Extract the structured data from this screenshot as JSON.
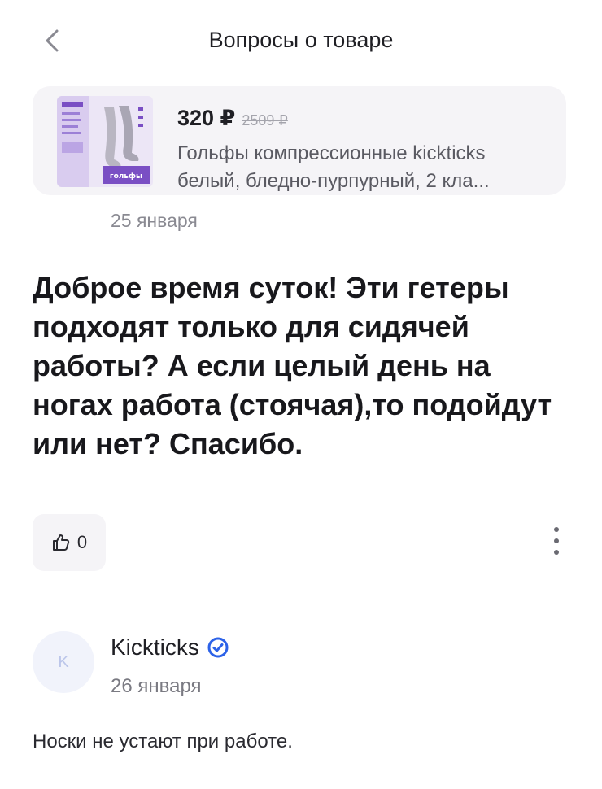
{
  "header": {
    "title": "Вопросы о товаре",
    "back_icon": "chevron-left-icon"
  },
  "product": {
    "price": "320 ₽",
    "old_price": "2509 ₽",
    "name_line1": "Гольфы компрессионные kickticks",
    "name_line2": "белый, бледно-пурпурный, 2 кла...",
    "thumb_label": "гольфы"
  },
  "question": {
    "date": "25 января",
    "text": "Доброе время суток! Эти гетеры подходят только для сидячей работы? А если целый день на ногах работа (стоячая),то подойдут или нет? Спасибо.",
    "likes": "0"
  },
  "answer": {
    "avatar_letter": "K",
    "seller_name": "Kickticks",
    "date": "26 января",
    "text": "Носки не устают при работе."
  },
  "colors": {
    "verified": "#2c62e8",
    "card_bg": "#f5f4f7",
    "thumb_purple": "#7a4fc4"
  }
}
